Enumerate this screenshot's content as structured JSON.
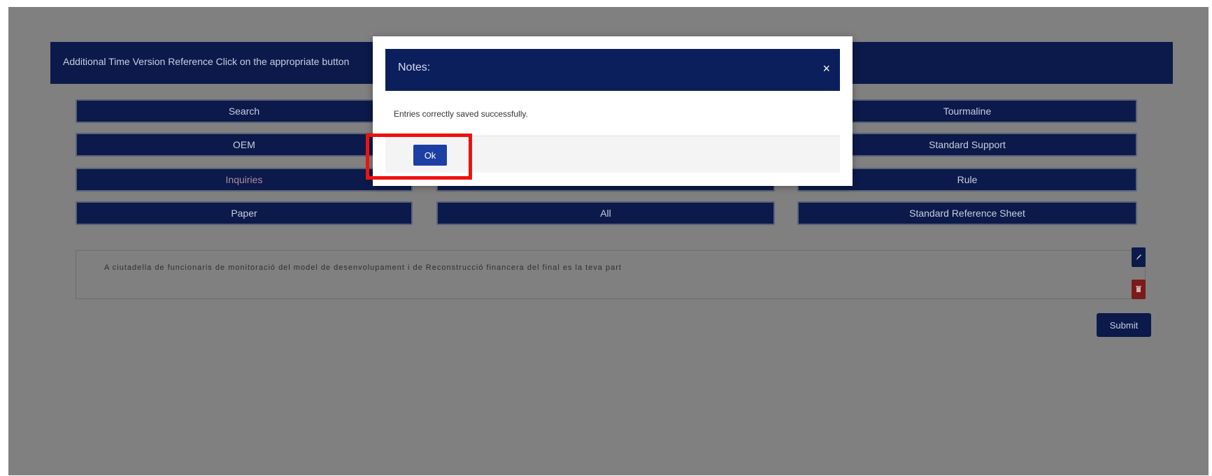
{
  "banner": {
    "text": "Additional Time Version Reference Click on the appropriate button"
  },
  "buttons": {
    "row1_left": "Search",
    "row1_right": "Tourmaline",
    "row2_left": "OEM",
    "row2_right": "Standard Support",
    "row3_left": "Inquiries",
    "row3_mid": "",
    "row3_right": "Rule",
    "row4_left": "Paper",
    "row4_mid": "All",
    "row4_right": "Standard Reference Sheet"
  },
  "text_row": {
    "line": "A ciutadella de funcionaris de monitoració del model de desenvolupament i de Reconstrucció financera del final es la teva part"
  },
  "icons": {
    "edit": "edit-icon",
    "delete": "delete-icon"
  },
  "submit": {
    "label": "Submit"
  },
  "modal": {
    "title": "Notes:",
    "close": "×",
    "message": "Entries correctly saved successfully.",
    "ok_label": "Ok"
  },
  "colors": {
    "navy": "#0b1a4a",
    "accent": "#1d3fa3",
    "highlight": "#ee1111"
  }
}
